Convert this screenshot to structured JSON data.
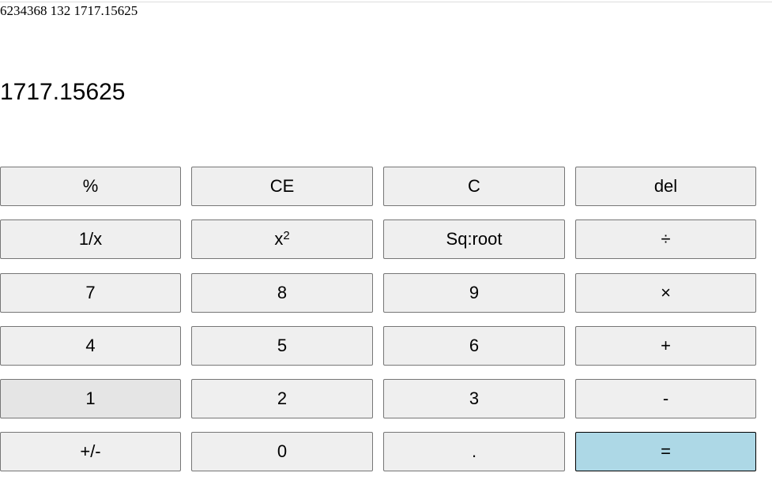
{
  "history": "6234368 132 1717.15625",
  "display": "1717.15625",
  "colors": {
    "key_background": "#efefef",
    "key_hover_background": "#e5e5e5",
    "equals_background": "#add8e6",
    "key_border": "#767676"
  },
  "keys": {
    "percent": "%",
    "clear_entry": "CE",
    "clear": "C",
    "delete": "del",
    "reciprocal": "1/x",
    "square_base": "x",
    "square_exp": "2",
    "sqrt": "Sq:root",
    "divide": "÷",
    "seven": "7",
    "eight": "8",
    "nine": "9",
    "multiply": "×",
    "four": "4",
    "five": "5",
    "six": "6",
    "plus": "+",
    "one": "1",
    "two": "2",
    "three": "3",
    "minus": "-",
    "negate": "+/-",
    "zero": "0",
    "decimal": ".",
    "equals": "="
  }
}
